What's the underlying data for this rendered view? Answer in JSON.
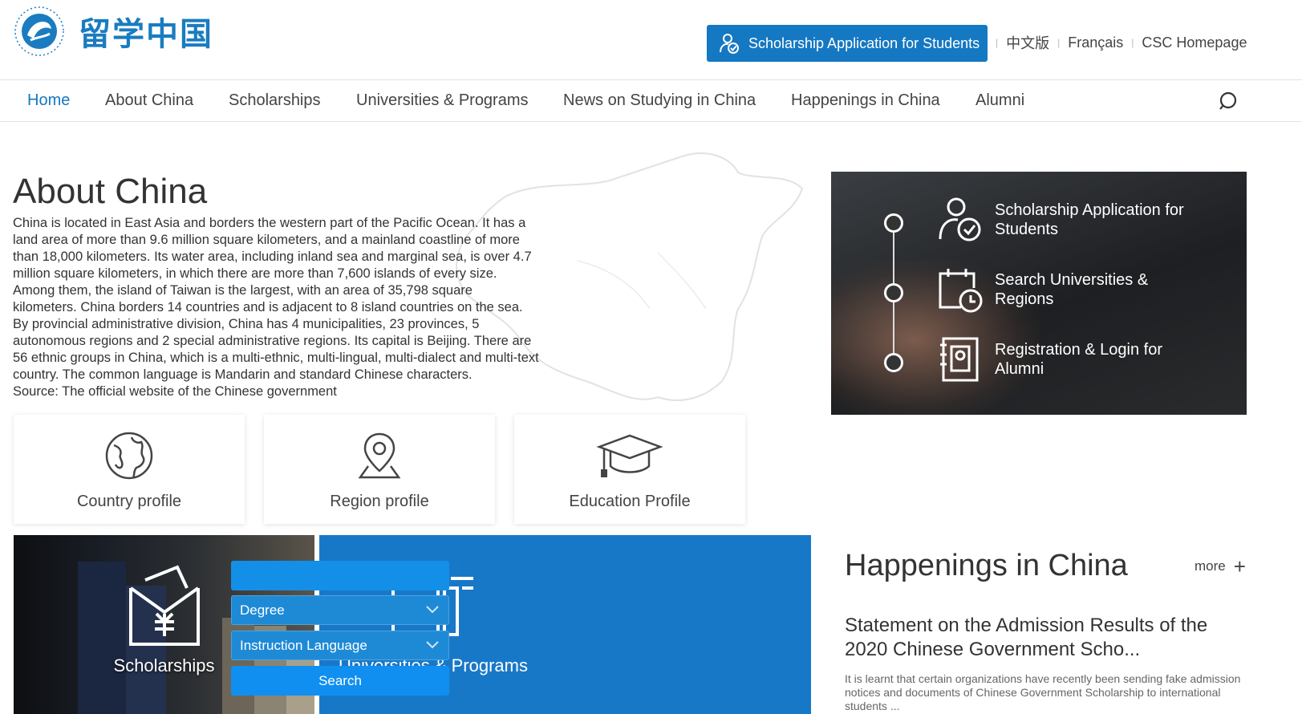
{
  "brand": {
    "logo_text": "留学中国"
  },
  "header": {
    "apply_button": "Scholarship Application for Students",
    "lang_links": [
      "中文版",
      "Français",
      "CSC Homepage"
    ]
  },
  "nav": {
    "items": [
      "Home",
      "About China",
      "Scholarships",
      "Universities & Programs",
      "News on Studying in China",
      "Happenings in China",
      "Alumni"
    ],
    "active": "Home"
  },
  "about": {
    "title": "About China",
    "text": "China is located in East Asia and borders the western part of the Pacific Ocean. It has a\nland area of more than 9.6 million square kilometers, and a mainland coastline of more\nthan 18,000 kilometers. Its water area, including inland sea and marginal sea, is over 4.7\nmillion square kilometers, in which there are more than 7,600 islands of every size.\nAmong them, the island of Taiwan is the largest, with an area of 35,798 square\nkilometers. China borders 14 countries and is adjacent to 8 island countries on the sea.\nBy provincial administrative division, China has 4 municipalities, 23 provinces, 5\nautonomous regions and 2 special administrative regions. Its capital is Beijing. There are\n56 ethnic groups in China, which is a multi-ethnic, multi-lingual, multi-dialect and multi-text\ncountry. The common language is Mandarin and standard Chinese characters.\nSource: The official website of the Chinese government",
    "cards": [
      "Country profile",
      "Region profile",
      "Education Profile"
    ]
  },
  "quick_links": [
    "Scholarship Application for Students",
    "Search Universities & Regions",
    "Registration & Login for Alumni"
  ],
  "tiles": {
    "scholarships": "Scholarships",
    "universities": "Universities & Programs",
    "input_value": "",
    "degree_select": "Degree",
    "language_select": "Instruction Language",
    "search_button": "Search"
  },
  "happenings": {
    "title": "Happenings in China",
    "more": "more",
    "headline": "Statement on the Admission Results of the 2020 Chinese Government Scho...",
    "summary": "It is learnt that certain organizations have recently been sending fake admission notices and documents of Chinese Government Scholarship to international students ..."
  },
  "colors": {
    "brand_blue": "#1578c2",
    "tile_blue": "#1878c8",
    "dark_panel": "#2a2c2f"
  }
}
